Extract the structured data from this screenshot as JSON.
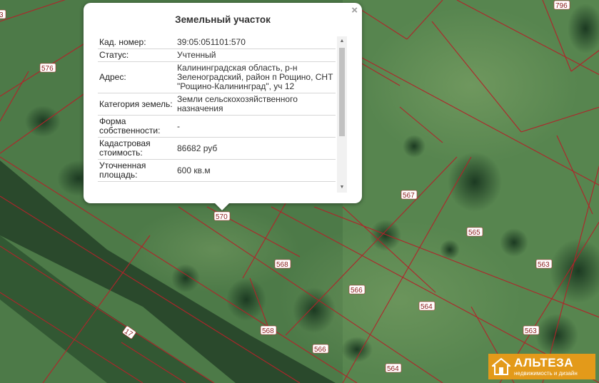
{
  "popup": {
    "title": "Земельный участок",
    "close_icon": "×",
    "rows": [
      {
        "key": "Кад. номер:",
        "value": "39:05:051101:570"
      },
      {
        "key": "Статус:",
        "value": "Учтенный"
      },
      {
        "key": "Адрес:",
        "value": "Калининградская область, р-н Зеленоградский, район п Рощино, СНТ \"Рощино-Калининград\", уч 12"
      },
      {
        "key": "Категория земель:",
        "value": "Земли сельскохозяйственного назначения"
      },
      {
        "key": "Форма собственности:",
        "value": "-"
      },
      {
        "key": "Кадастровая стоимость:",
        "value": "86682 руб"
      },
      {
        "key": "Уточненная площадь:",
        "value": "600 кв.м"
      }
    ],
    "scroll_up_icon": "▲",
    "scroll_down_icon": "▼"
  },
  "map": {
    "plot_labels": [
      "3",
      "576",
      "796",
      "570",
      "567",
      "565",
      "568",
      "566",
      "563",
      "564",
      "17",
      "568",
      "566",
      "563",
      "564"
    ]
  },
  "logo": {
    "name": "АЛЬТЕЗА",
    "tagline": "недвижимость и дизайн",
    "accent_color": "#e39a1a"
  }
}
